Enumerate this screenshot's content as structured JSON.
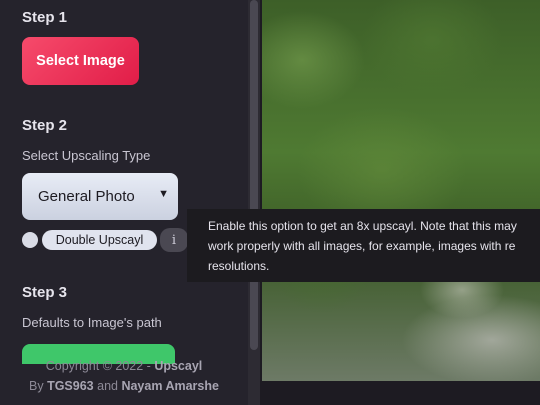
{
  "step1": {
    "title": "Step 1",
    "button_label": "Select Image"
  },
  "step2": {
    "title": "Step 2",
    "subtitle": "Select Upscaling Type",
    "select_value": "General Photo",
    "double_upscayl_label": "Double Upscayl",
    "info_icon": "i"
  },
  "step3": {
    "title": "Step 3",
    "subtitle": "Defaults to Image's path"
  },
  "tooltip": {
    "line1": "Enable this option to get an 8x upscayl. Note that this may",
    "line2": "work properly with all images, for example, images with re",
    "line3": "resolutions."
  },
  "footer": {
    "copyright_prefix": "Copyright © 2022 - ",
    "app_name": "Upscayl",
    "by": "By ",
    "author1": "TGS963",
    "and": " and ",
    "author2": "Nayam Amarshe"
  },
  "colors": {
    "accent_gradient_start": "#f64b6b",
    "accent_gradient_end": "#e11d48",
    "green_button": "#3fc76a",
    "sidebar_bg": "#25232c"
  },
  "icons": {
    "select_chevron": "chevron-down-icon",
    "info": "info-icon"
  }
}
